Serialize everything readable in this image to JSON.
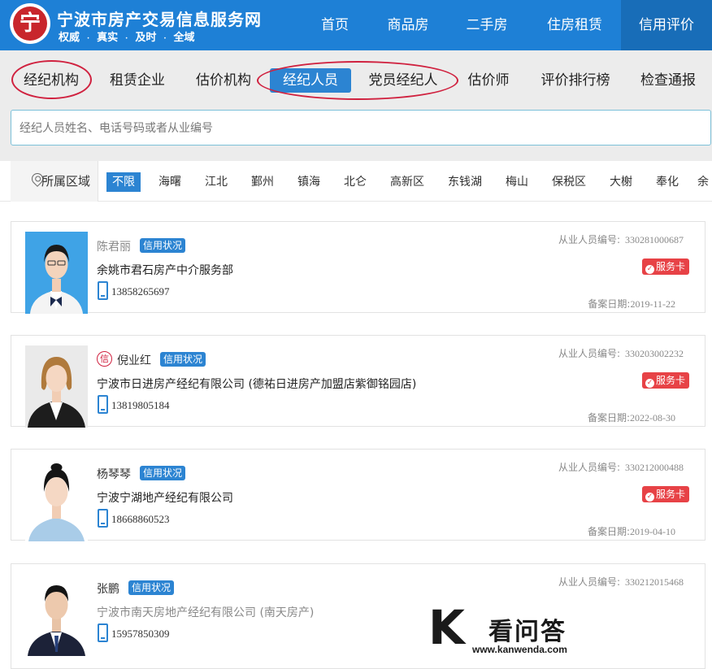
{
  "header": {
    "logo_char": "宁",
    "site_title": "宁波市房产交易信息服务网",
    "slogan": [
      "权威",
      "真实",
      "及时",
      "全域"
    ],
    "slogan_sep": "·",
    "nav": [
      {
        "label": "首页"
      },
      {
        "label": "商品房"
      },
      {
        "label": "二手房"
      },
      {
        "label": "住房租赁"
      },
      {
        "label": "信用评价",
        "active": true
      }
    ]
  },
  "subnav": {
    "tabs": [
      {
        "label": "经纪机构"
      },
      {
        "label": "租赁企业"
      },
      {
        "label": "估价机构"
      },
      {
        "label": "经纪人员",
        "active": true
      },
      {
        "label": "党员经纪人"
      },
      {
        "label": "估价师"
      },
      {
        "label": "评价排行榜"
      },
      {
        "label": "检查通报"
      }
    ]
  },
  "search": {
    "placeholder": "经纪人员姓名、电话号码或者从业编号",
    "value": ""
  },
  "regions": {
    "label": "所属区域",
    "items": [
      "不限",
      "海曙",
      "江北",
      "鄞州",
      "镇海",
      "北仑",
      "高新区",
      "东钱湖",
      "梅山",
      "保税区",
      "大榭",
      "奉化",
      "余"
    ]
  },
  "labels": {
    "credit_status": "信用状况",
    "reg_no_label": "从业人员编号:",
    "service_card": "服务卡",
    "filed_date_label": "备案日期:",
    "xin": "信"
  },
  "agents": [
    {
      "name": "陈君丽",
      "company": "余姚市君石房产中介服务部",
      "phone": "13858265697",
      "reg_no": "330281000687",
      "filed_date": "2019-11-22"
    },
    {
      "name": "倪业红",
      "company": "宁波市日进房产经纪有限公司 (德祐日进房产加盟店紫御铭园店)",
      "phone": "13819805184",
      "reg_no": "330203002232",
      "filed_date": "2022-08-30"
    },
    {
      "name": "杨琴琴",
      "company": "宁波宁湖地产经纪有限公司",
      "phone": "18668860523",
      "reg_no": "330212000488",
      "filed_date": "2019-04-10"
    },
    {
      "name": "张鹏",
      "company": "宁波市南天房地产经纪有限公司 (南天房产)",
      "phone": "15957850309",
      "reg_no": "330212015468",
      "filed_date": ""
    }
  ],
  "watermark": {
    "text": "看问答",
    "url": "www.kanwenda.com"
  },
  "colors": {
    "header_blue": "#1e80d6",
    "accent_blue": "#2c84d2",
    "annotation_red": "#d0213f",
    "service_red": "#e74246"
  }
}
